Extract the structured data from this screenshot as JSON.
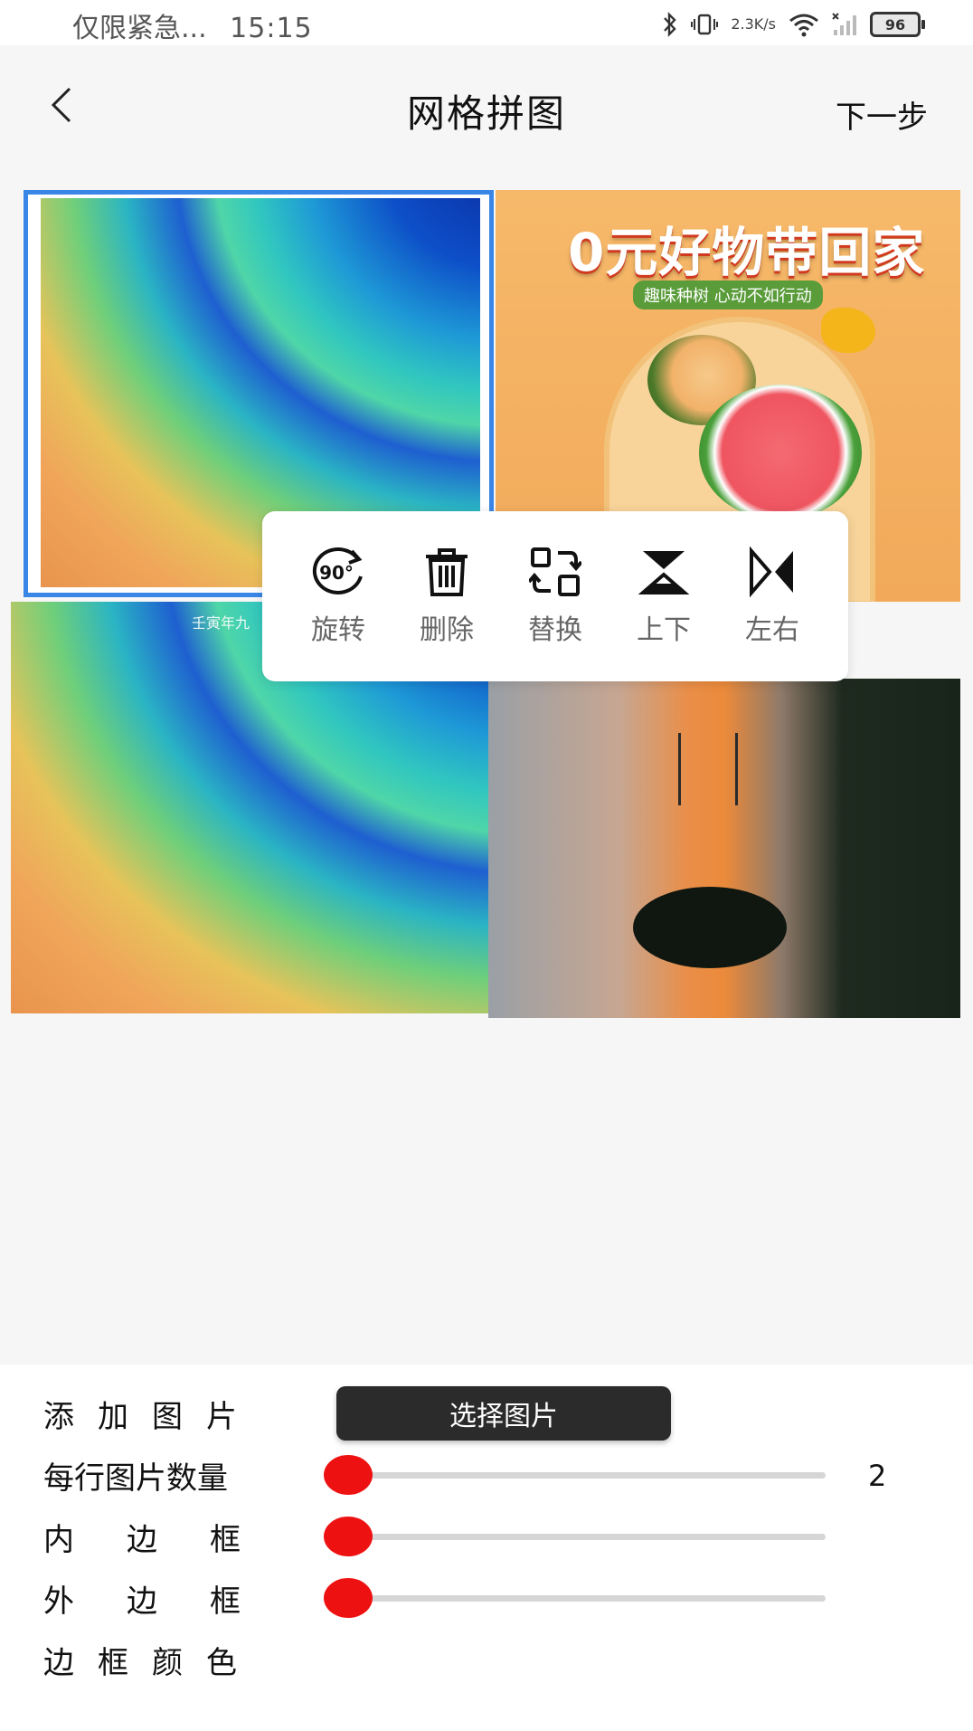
{
  "status_bar": {
    "left_text": "仅限紧急...",
    "time": "15:15",
    "net_speed_value": "2.3",
    "net_speed_unit": "K/s",
    "battery": "96",
    "icons": [
      "bluetooth-icon",
      "vibrate-icon",
      "wifi-icon",
      "signal-icon",
      "battery-icon"
    ]
  },
  "header": {
    "title": "网格拼图",
    "next_label": "下一步"
  },
  "grid": {
    "cell2_title": "0元好物带回家",
    "cell2_subtitle": "趣味种树 心动不如行动",
    "cell3_tag": "壬寅年九",
    "selected_cell": 1,
    "selection_color": "#3a86e6"
  },
  "actions": [
    {
      "label": "旋转",
      "icon": "rotate-90-icon"
    },
    {
      "label": "删除",
      "icon": "trash-icon"
    },
    {
      "label": "替换",
      "icon": "replace-icon"
    },
    {
      "label": "上下",
      "icon": "flip-vertical-icon"
    },
    {
      "label": "左右",
      "icon": "flip-horizontal-icon"
    }
  ],
  "panel": {
    "add_image_label": "添加图片",
    "select_button_label": "选择图片",
    "per_row_label": "每行图片数量",
    "per_row_value": "2",
    "inner_border_label": "内边框",
    "outer_border_label": "外边框",
    "border_color_label": "边框颜色",
    "slider_thumb_color": "#ee1111"
  }
}
